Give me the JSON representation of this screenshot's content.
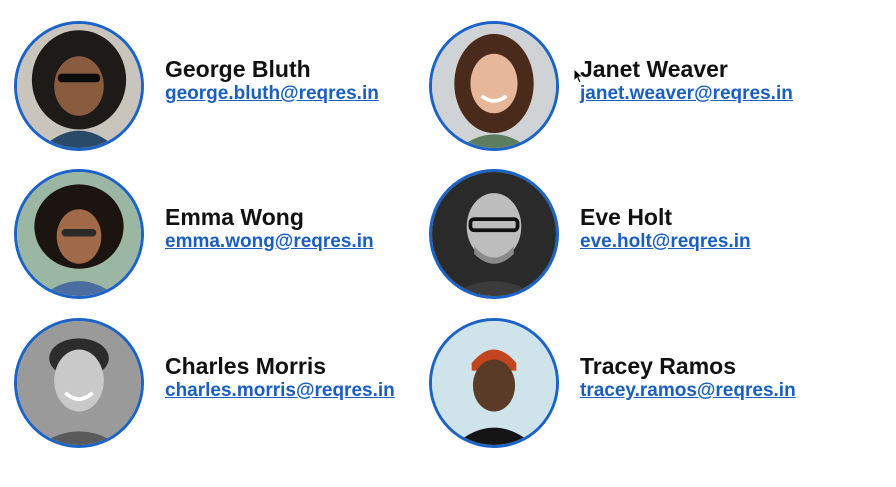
{
  "users": [
    {
      "name": "George Bluth",
      "email": "george.bluth@reqres.in"
    },
    {
      "name": "Janet Weaver",
      "email": "janet.weaver@reqres.in"
    },
    {
      "name": "Emma Wong",
      "email": "emma.wong@reqres.in"
    },
    {
      "name": "Eve Holt",
      "email": "eve.holt@reqres.in"
    },
    {
      "name": "Charles Morris",
      "email": "charles.morris@reqres.in"
    },
    {
      "name": "Tracey Ramos",
      "email": "tracey.ramos@reqres.in"
    }
  ],
  "colors": {
    "accent": "#1c63c7",
    "link": "#1a5fc0",
    "text": "#111111"
  }
}
